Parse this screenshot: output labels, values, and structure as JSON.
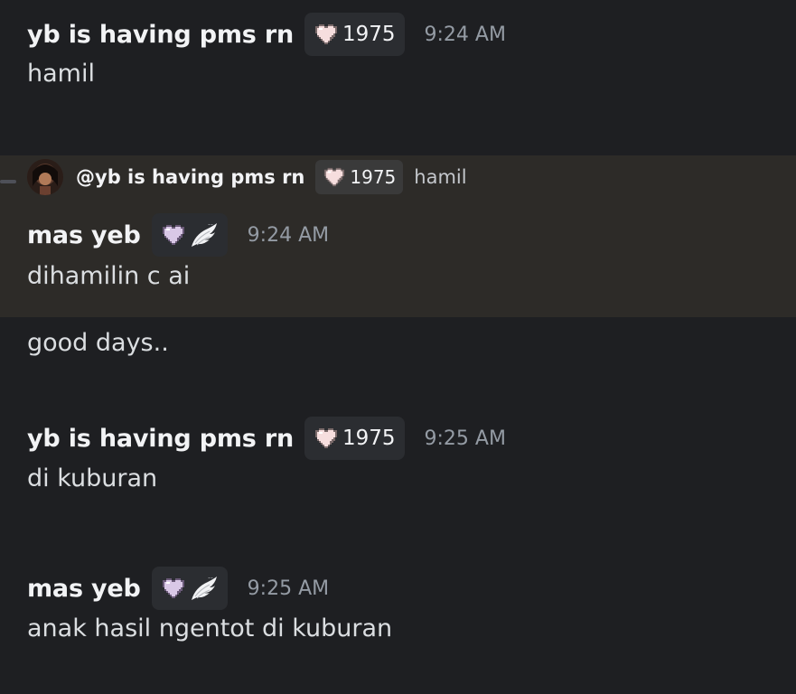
{
  "messages": [
    {
      "author": "yb is having pms rn",
      "tag": "1975",
      "tag_icon": "pink-heart-icon",
      "time": "9:24 AM",
      "text": "hamil"
    },
    {
      "reply": {
        "author": "@yb is having pms rn",
        "tag": "1975",
        "tag_icon": "pink-heart-icon",
        "text": "hamil"
      },
      "author": "mas yeb",
      "tag_icons": [
        "lavender-heart-icon",
        "white-wing-icon"
      ],
      "time": "9:24 AM",
      "text": "dihamilin c ai"
    },
    {
      "text": "good days.."
    },
    {
      "author": "yb is having pms rn",
      "tag": "1975",
      "tag_icon": "pink-heart-icon",
      "time": "9:25 AM",
      "text": "di kuburan"
    },
    {
      "author": "mas yeb",
      "tag_icons": [
        "lavender-heart-icon",
        "white-wing-icon"
      ],
      "time": "9:25 AM",
      "text": "anak hasil ngentot di kuburan"
    }
  ],
  "colors": {
    "background": "#1e1f22",
    "highlight": "#2d2b28",
    "tag_bg": "#2b2d31",
    "username": "#f2f3f5",
    "timestamp": "#949ba4",
    "text": "#dbdee1",
    "pink_heart": "#f6dede",
    "lavender_heart": "#d9c8e6"
  }
}
